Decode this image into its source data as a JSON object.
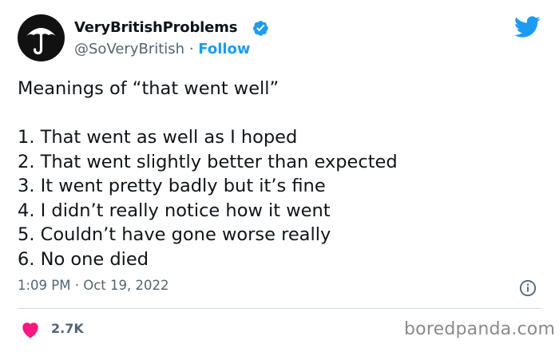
{
  "author": {
    "display_name": "VeryBritishProblems",
    "handle": "@SoVeryBritish",
    "separator": "·",
    "follow_label": "Follow"
  },
  "tweet": {
    "text": "Meanings of “that went well”\n\n1. That went as well as I hoped\n2. That went slightly better than expected\n3. It went pretty badly but it’s fine\n4. I didn’t really notice how it went\n5. Couldn’t have gone worse really\n6. No one died",
    "timestamp": "1:09 PM · Oct 19, 2022",
    "likes": "2.7K"
  },
  "watermark": "boredpanda.com",
  "colors": {
    "accent": "#1d9bf0",
    "heart": "#f91880",
    "muted": "#536471"
  },
  "icons": [
    "umbrella-avatar-icon",
    "verified-badge-icon",
    "twitter-bird-icon",
    "info-icon",
    "heart-icon"
  ]
}
